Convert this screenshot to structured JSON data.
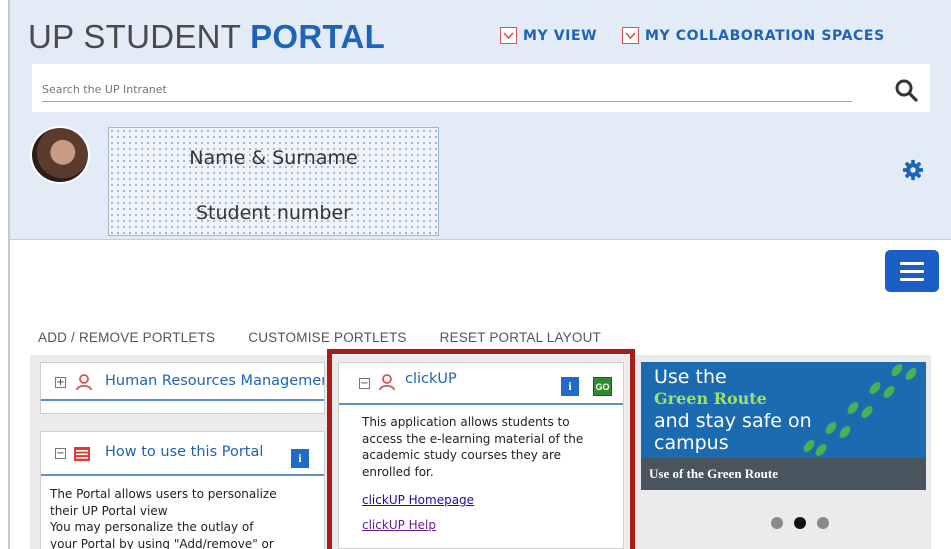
{
  "header": {
    "brand_prefix": "UP STUDENT ",
    "brand_bold": "PORTAL",
    "nav": [
      {
        "label": "MY VIEW",
        "icon": "chevron-down-icon"
      },
      {
        "label": "MY COLLABORATION SPACES",
        "icon": "chevron-down-icon"
      }
    ]
  },
  "search": {
    "placeholder": "Search the UP Intranet",
    "icon": "search-icon"
  },
  "user": {
    "name": "Name & Surname",
    "student_number": "Student number",
    "avatar_icon": "avatar",
    "settings_icon": "gear-icon"
  },
  "menu": {
    "icon": "hamburger-menu-icon"
  },
  "actions": [
    "ADD / REMOVE PORTLETS",
    "CUSTOMISE PORTLETS",
    "RESET PORTAL LAYOUT"
  ],
  "portlets": {
    "hr": {
      "title": "Human Resources Management",
      "toggle": "+"
    },
    "howto": {
      "title": "How to use this Portal",
      "toggle": "−",
      "info": "i",
      "body": [
        "The Portal allows users to personalize",
        "their UP Portal view",
        "You may personalize the outlay of",
        "your Portal by using \"Add/remove\" or"
      ]
    },
    "clickup": {
      "title": "clickUP",
      "toggle": "−",
      "info": "i",
      "go": "GO",
      "body": [
        "This application allows students to",
        "access the e-learning material of the",
        "academic study courses they are",
        "enrolled for."
      ],
      "links": [
        "clickUP Homepage",
        "clickUP Help"
      ]
    }
  },
  "banner": {
    "line1": "Use the",
    "line2": "Green Route",
    "line3": "and stay safe on",
    "line4": "campus",
    "caption": "Use of the Green Route",
    "active_slide": 2,
    "slide_count": 3
  },
  "colors": {
    "brand_blue": "#1d63b8",
    "header_bg": "#e3ecf6",
    "highlight_red": "#a91c1c",
    "go_green": "#2e8b2e",
    "menu_blue": "#1b5fc6"
  }
}
